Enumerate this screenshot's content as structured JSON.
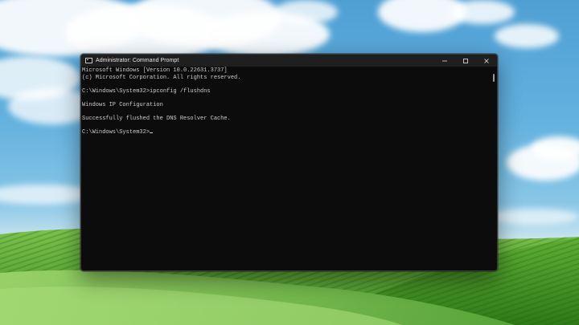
{
  "window": {
    "title": "Administrator: Command Prompt",
    "controls": {
      "minimize": "minimize",
      "maximize": "maximize",
      "close": "close"
    }
  },
  "console": {
    "lines": [
      "Microsoft Windows [Version 10.0.22631.3737]",
      "(c) Microsoft Corporation. All rights reserved.",
      "",
      "C:\\Windows\\System32>ipconfig /flushdns",
      "",
      "Windows IP Configuration",
      "",
      "Successfully flushed the DNS Resolver Cache.",
      "",
      "C:\\Windows\\System32>"
    ]
  },
  "colors": {
    "console_bg": "#0c0c0c",
    "console_text": "#cccccc",
    "titlebar_bg": "#1f1f1f"
  }
}
